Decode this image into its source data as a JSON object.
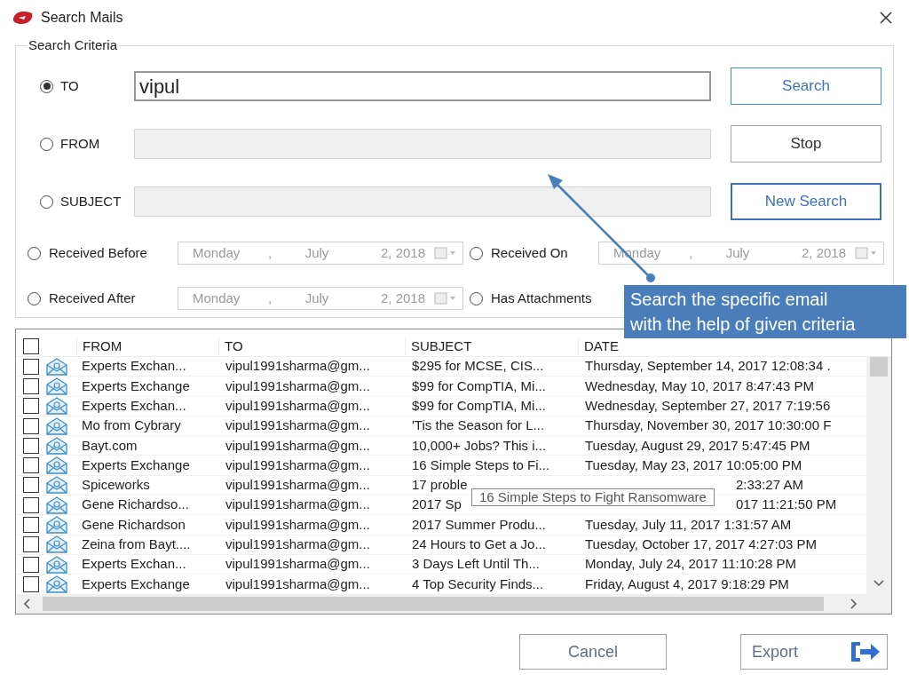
{
  "window": {
    "title": "Search Mails"
  },
  "search_criteria": {
    "title": "Search Criteria",
    "text_filters": [
      {
        "label": "TO",
        "selected": true,
        "value": "vipul"
      },
      {
        "label": "FROM",
        "selected": false
      },
      {
        "label": "SUBJECT",
        "selected": false
      }
    ],
    "action_buttons": [
      {
        "label": "Search",
        "kind": "accent"
      },
      {
        "label": "Stop",
        "kind": "plain"
      },
      {
        "label": "New Search",
        "kind": "focused"
      }
    ],
    "date_filters": [
      {
        "label": "Received Before",
        "selected": false,
        "day": "Monday",
        "separator": ",",
        "month": "July",
        "date": "2, 2018"
      },
      {
        "label": "Received On",
        "selected": false,
        "day": "Monday",
        "separator": ",",
        "month": "July",
        "date": "2, 2018"
      },
      {
        "label": "Received After",
        "selected": false,
        "day": "Monday",
        "separator": ",",
        "month": "July",
        "date": "2, 2018"
      }
    ],
    "attachments": {
      "label": "Has Attachments",
      "selected": false
    }
  },
  "table": {
    "all_checked": false,
    "columns": [
      "FROM",
      "TO",
      "SUBJECT",
      "DATE"
    ],
    "rows": [
      {
        "checked": false,
        "from": "Experts Exchan...",
        "to": "vipul1991sharma@gm...",
        "subject": "$295 for MCSE, CIS...",
        "date": "Thursday, September 14, 2017 12:08:34 ."
      },
      {
        "checked": false,
        "from": "Experts Exchange",
        "to": "vipul1991sharma@gm...",
        "subject": "$99 for CompTIA, Mi...",
        "date": "Wednesday, May 10, 2017 8:47:43 PM"
      },
      {
        "checked": false,
        "from": "Experts Exchan...",
        "to": "vipul1991sharma@gm...",
        "subject": "$99 for CompTIA, Mi...",
        "date": "Wednesday, September 27, 2017 7:19:56"
      },
      {
        "checked": false,
        "from": "Mo from Cybrary",
        "to": "vipul1991sharma@gm...",
        "subject": "'Tis the Season for L...",
        "date": "Thursday, November 30, 2017 10:30:00 F"
      },
      {
        "checked": false,
        "from": "Bayt.com",
        "to": "vipul1991sharma@gm...",
        "subject": "10,000+ Jobs? This i...",
        "date": "Tuesday, August 29, 2017 5:47:45 PM"
      },
      {
        "checked": false,
        "from": "Experts Exchange",
        "to": "vipul1991sharma@gm...",
        "subject": "16 Simple Steps to Fi...",
        "date": "Tuesday, May 23, 2017 10:05:00 PM"
      },
      {
        "checked": false,
        "from": "Spiceworks",
        "to": "vipul1991sharma@gm...",
        "subject": "17 proble",
        "date": "2:33:27 AM",
        "covered": true
      },
      {
        "checked": false,
        "from": "Gene Richardso...",
        "to": "vipul1991sharma@gm...",
        "subject": "2017 Sp",
        "date": "017 11:21:50 PM",
        "covered": true
      },
      {
        "checked": false,
        "from": "Gene Richardson",
        "to": "vipul1991sharma@gm...",
        "subject": "2017 Summer Produ...",
        "date": "Tuesday, July 11, 2017 1:31:57 AM"
      },
      {
        "checked": false,
        "from": "Zeina from Bayt....",
        "to": "vipul1991sharma@gm...",
        "subject": "24 Hours to Get a Jo...",
        "date": "Tuesday, October 17, 2017 4:27:03 PM"
      },
      {
        "checked": false,
        "from": "Experts Exchan...",
        "to": "vipul1991sharma@gm...",
        "subject": "3 Days Left Until Th...",
        "date": "Monday, July 24, 2017 11:10:28 PM"
      },
      {
        "checked": false,
        "from": "Experts Exchange",
        "to": "vipul1991sharma@gm...",
        "subject": "4 Top Security Finds...",
        "date": "Friday, August 4, 2017 9:18:29 PM"
      }
    ]
  },
  "tooltip": "16 Simple Steps to Fight Ransomware",
  "callout": {
    "lines": [
      "Search the specific email",
      "with the help of given criteria"
    ]
  },
  "footer_buttons": [
    {
      "label": "Cancel",
      "kind": "plain"
    },
    {
      "label": "Export",
      "kind": "export"
    }
  ]
}
